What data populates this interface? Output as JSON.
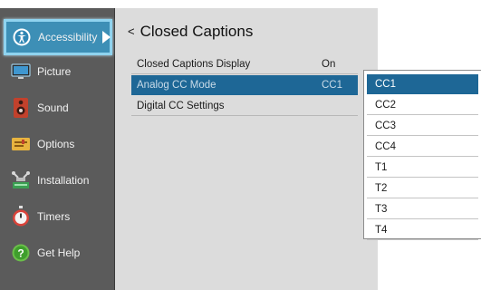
{
  "sidebar": {
    "items": [
      {
        "label": "Accessibility",
        "icon": "accessibility-icon",
        "selected": true
      },
      {
        "label": "Picture",
        "icon": "monitor-icon"
      },
      {
        "label": "Sound",
        "icon": "speaker-icon"
      },
      {
        "label": "Options",
        "icon": "options-icon"
      },
      {
        "label": "Installation",
        "icon": "installation-icon"
      },
      {
        "label": "Timers",
        "icon": "timer-icon"
      },
      {
        "label": "Get Help",
        "icon": "help-icon"
      }
    ]
  },
  "main": {
    "back_glyph": "<",
    "title": "Closed Captions",
    "rows": [
      {
        "label": "Closed Captions Display",
        "value": "On"
      },
      {
        "label": "Analog CC Mode",
        "value": "CC1",
        "highlighted": true
      },
      {
        "label": "Digital CC Settings",
        "value": ""
      }
    ]
  },
  "dropdown": {
    "selected": "CC1",
    "options": [
      "CC1",
      "CC2",
      "CC3",
      "CC4",
      "T1",
      "T2",
      "T3",
      "T4"
    ]
  },
  "colors": {
    "sidebar_bg": "#5b5b5b",
    "selected_accent": "#3d8fb6",
    "highlight_row": "#1e6796",
    "panel_bg": "#dcdcdc"
  }
}
